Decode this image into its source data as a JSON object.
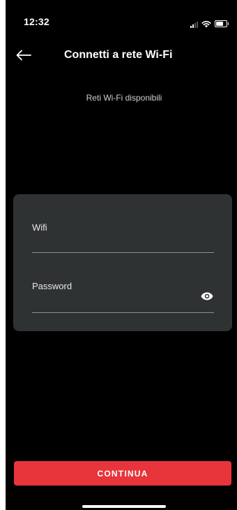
{
  "status_bar": {
    "time": "12:32",
    "icons": [
      "signal-icon",
      "wifi-icon",
      "battery-icon"
    ]
  },
  "header": {
    "title": "Connetti a rete Wi-Fi",
    "back_icon": "arrow-left-icon"
  },
  "subtitle": "Reti Wi-Fi disponibili",
  "form": {
    "wifi_label": "Wifi",
    "wifi_value": "",
    "password_label": "Password",
    "password_value": "",
    "password_toggle_icon": "eye-icon"
  },
  "actions": {
    "continue_label": "CONTINUA"
  },
  "colors": {
    "background": "#000000",
    "card": "#2f3233",
    "accent": "#e8343b",
    "divider": "#8c8f90",
    "text": "#ffffff"
  }
}
